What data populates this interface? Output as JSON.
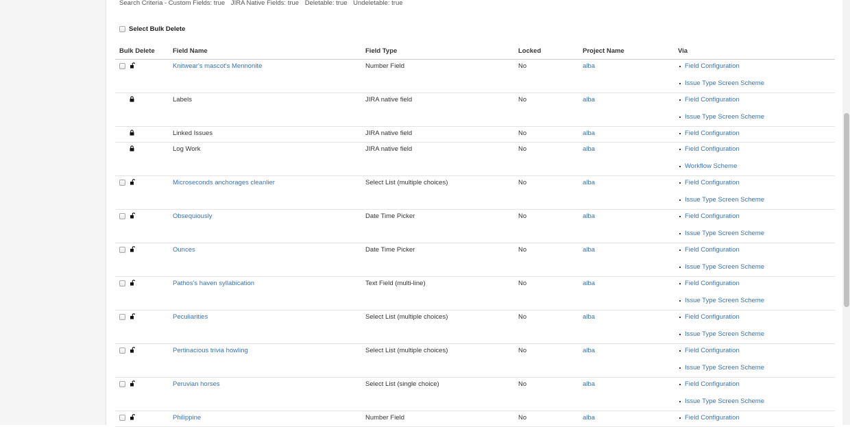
{
  "criteria": {
    "prefix": "Search Criteria - Custom Fields: true",
    "native": "JIRA Native Fields: true",
    "deletable": "Deletable: true",
    "undeletable": "Undeletable: true"
  },
  "bulk_select_label": "Select Bulk Delete",
  "columns": {
    "bulk": "Bulk Delete",
    "name": "Field Name",
    "type": "Field Type",
    "locked": "Locked",
    "project": "Project Name",
    "via": "Via"
  },
  "rows": [
    {
      "name": "Knitwear's mascot's Mennonite",
      "type": "Number Field",
      "locked": "No",
      "project": "alba",
      "via": [
        "Field Configuration",
        "Issue Type Screen Scheme"
      ],
      "deletable": true
    },
    {
      "name": "Labels",
      "type": "JIRA native field",
      "locked": "No",
      "project": "alba",
      "via": [
        "Field Configuration",
        "Issue Type Screen Scheme"
      ],
      "deletable": false
    },
    {
      "name": "Linked Issues",
      "type": "JIRA native field",
      "locked": "No",
      "project": "alba",
      "via": [
        "Field Configuration"
      ],
      "deletable": false
    },
    {
      "name": "Log Work",
      "type": "JIRA native field",
      "locked": "No",
      "project": "alba",
      "via": [
        "Field Configuration",
        "Workflow Scheme"
      ],
      "deletable": false
    },
    {
      "name": "Microseconds anchorages cleanlier",
      "type": "Select List (multiple choices)",
      "locked": "No",
      "project": "alba",
      "via": [
        "Field Configuration",
        "Issue Type Screen Scheme"
      ],
      "deletable": true
    },
    {
      "name": "Obsequiously",
      "type": "Date Time Picker",
      "locked": "No",
      "project": "alba",
      "via": [
        "Field Configuration",
        "Issue Type Screen Scheme"
      ],
      "deletable": true
    },
    {
      "name": "Ounces",
      "type": "Date Time Picker",
      "locked": "No",
      "project": "alba",
      "via": [
        "Field Configuration",
        "Issue Type Screen Scheme"
      ],
      "deletable": true
    },
    {
      "name": "Pathos's haven syllabication",
      "type": "Text Field (multi-line)",
      "locked": "No",
      "project": "alba",
      "via": [
        "Field Configuration",
        "Issue Type Screen Scheme"
      ],
      "deletable": true
    },
    {
      "name": "Peculiarities",
      "type": "Select List (multiple choices)",
      "locked": "No",
      "project": "alba",
      "via": [
        "Field Configuration",
        "Issue Type Screen Scheme"
      ],
      "deletable": true
    },
    {
      "name": "Pertinacious trivia howling",
      "type": "Select List (multiple choices)",
      "locked": "No",
      "project": "alba",
      "via": [
        "Field Configuration",
        "Issue Type Screen Scheme"
      ],
      "deletable": true
    },
    {
      "name": "Peruvian horses",
      "type": "Select List (single choice)",
      "locked": "No",
      "project": "alba",
      "via": [
        "Field Configuration",
        "Issue Type Screen Scheme"
      ],
      "deletable": true
    },
    {
      "name": "Philippine",
      "type": "Number Field",
      "locked": "No",
      "project": "alba",
      "via": [
        "Field Configuration"
      ],
      "deletable": true
    }
  ]
}
